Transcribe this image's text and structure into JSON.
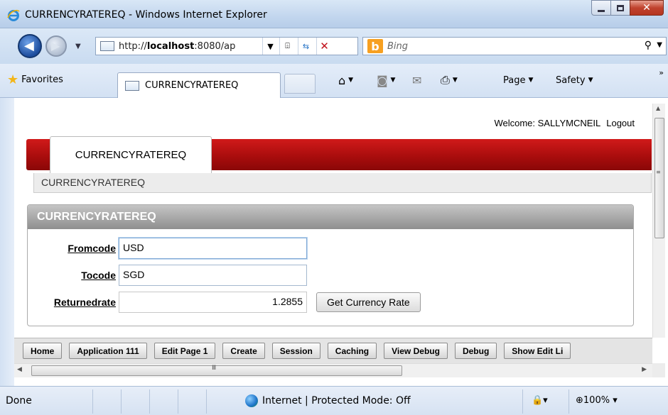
{
  "window": {
    "title": "CURRENCYRATEREQ - Windows Internet Explorer",
    "colors": {
      "title_bg": "#c9dbf0",
      "close_btn": "#c0432e"
    }
  },
  "address_bar": {
    "url_prefix": "http://",
    "url_host": "localhost",
    "url_rest": ":8080/ap"
  },
  "search": {
    "placeholder": "Bing",
    "logo": "b"
  },
  "favorites_bar": {
    "favorites_label": "Favorites",
    "tab_title": "CURRENCYRATEREQ",
    "page_menu": "Page",
    "safety_menu": "Safety"
  },
  "page": {
    "welcome_label": "Welcome: SALLYMCNEIL",
    "logout_label": "Logout",
    "tab_label": "CURRENCYRATEREQ",
    "breadcrumb": "CURRENCYRATEREQ",
    "accent_color": "#b10f0f",
    "region": {
      "title": "CURRENCYRATEREQ",
      "fields": {
        "fromcode": {
          "label": "Fromcode",
          "value": "USD"
        },
        "tocode": {
          "label": "Tocode",
          "value": "SGD"
        },
        "returnedrate": {
          "label": "Returnedrate",
          "value": "1.2855"
        }
      },
      "button_label": "Get Currency Rate"
    },
    "dev_toolbar": [
      "Home",
      "Application 111",
      "Edit Page 1",
      "Create",
      "Session",
      "Caching",
      "View Debug",
      "Debug",
      "Show Edit Li"
    ]
  },
  "status_bar": {
    "status": "Done",
    "zone": "Internet | Protected Mode: Off",
    "zoom": "100%"
  }
}
